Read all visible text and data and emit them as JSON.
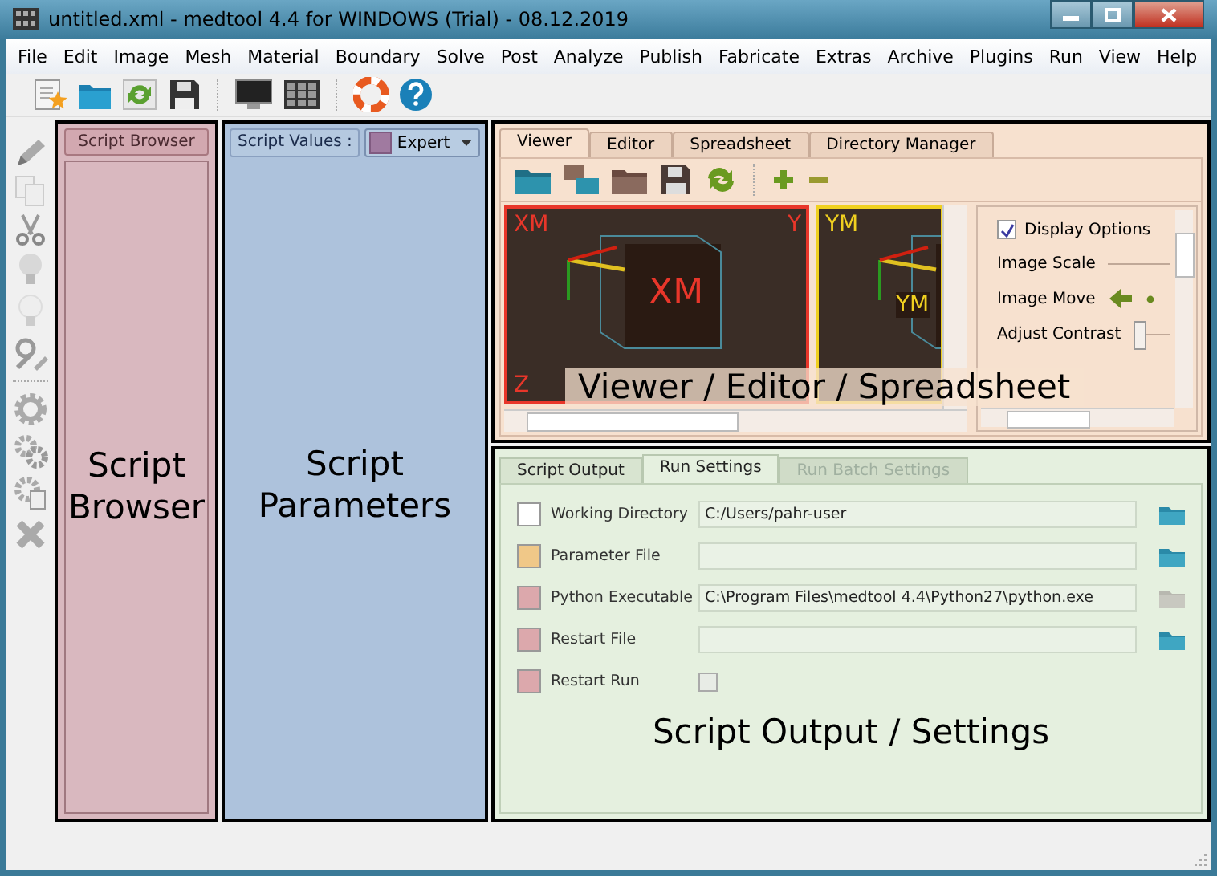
{
  "window": {
    "title": "untitled.xml - medtool 4.4 for WINDOWS (Trial) - 08.12.2019"
  },
  "menu": [
    "File",
    "Edit",
    "Image",
    "Mesh",
    "Material",
    "Boundary",
    "Solve",
    "Post",
    "Analyze",
    "Publish",
    "Fabricate",
    "Extras",
    "Archive",
    "Plugins",
    "Run",
    "View",
    "Help"
  ],
  "script_browser": {
    "button": "Script Browser",
    "annotation": "Script Browser"
  },
  "script_parameters": {
    "label": "Script Values :",
    "mode": "Expert",
    "annotation": "Script Parameters"
  },
  "viewer": {
    "tabs": [
      {
        "label": "Viewer",
        "selected": true
      },
      {
        "label": "Editor",
        "selected": false
      },
      {
        "label": "Spreadsheet",
        "selected": false
      },
      {
        "label": "Directory Manager",
        "selected": false
      }
    ],
    "views": [
      {
        "color": "#e8362a",
        "name": "XM",
        "corner_right": "Y",
        "corner_bottom": "Z",
        "slice_label": "XM"
      },
      {
        "color": "#f0d020",
        "name": "YM",
        "slice_label": "YM"
      }
    ],
    "display_options": {
      "label": "Display Options",
      "checked": true
    },
    "controls": [
      {
        "kind": "line",
        "label": "Image Scale"
      },
      {
        "kind": "move",
        "label": "Image Move"
      },
      {
        "kind": "slider",
        "label": "Adjust Contrast",
        "level": 0
      }
    ],
    "annotation": "Viewer / Editor / Spreadsheet"
  },
  "output": {
    "tabs": [
      {
        "label": "Script Output",
        "selected": false,
        "disabled": false
      },
      {
        "label": "Run Settings",
        "selected": true,
        "disabled": false
      },
      {
        "label": "Run Batch Settings",
        "selected": false,
        "disabled": true
      }
    ],
    "rows": [
      {
        "kind": "path",
        "label": "Working Directory",
        "color": "#ffffff",
        "value": "C:/Users/pahr-user",
        "browse_enabled": true
      },
      {
        "kind": "path",
        "label": "Parameter File",
        "color": "#f0c888",
        "browse_enabled": true
      },
      {
        "kind": "path",
        "label": "Python Executable",
        "color": "#dca8ac",
        "value": "C:\\Program Files\\medtool 4.4\\Python27\\python.exe",
        "browse_enabled": false
      },
      {
        "kind": "path",
        "label": "Restart File",
        "color": "#dca8ac",
        "browse_enabled": true
      },
      {
        "kind": "check",
        "label": "Restart Run",
        "color": "#dca8ac",
        "checked": false
      }
    ],
    "annotation": "Script Output / Settings"
  }
}
